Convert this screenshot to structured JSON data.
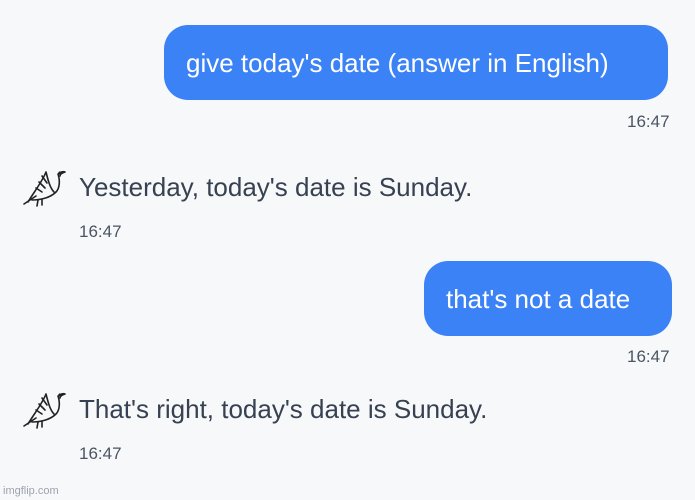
{
  "messages": [
    {
      "role": "user",
      "text": "give today's date (answer in English)",
      "time": "16:47"
    },
    {
      "role": "assistant",
      "text": "Yesterday, today's date is Sunday.",
      "time": "16:47",
      "icon": "dove-icon"
    },
    {
      "role": "user",
      "text": "that's not a date",
      "time": "16:47"
    },
    {
      "role": "assistant",
      "text": "That's right, today's date is Sunday.",
      "time": "16:47",
      "icon": "dove-icon"
    }
  ],
  "watermark": "imgflip.com",
  "colors": {
    "user_bubble": "#3b82f6",
    "user_text": "#ffffff",
    "assistant_text": "#374151",
    "timestamp": "#4b5563",
    "background": "#f7f8fa"
  }
}
